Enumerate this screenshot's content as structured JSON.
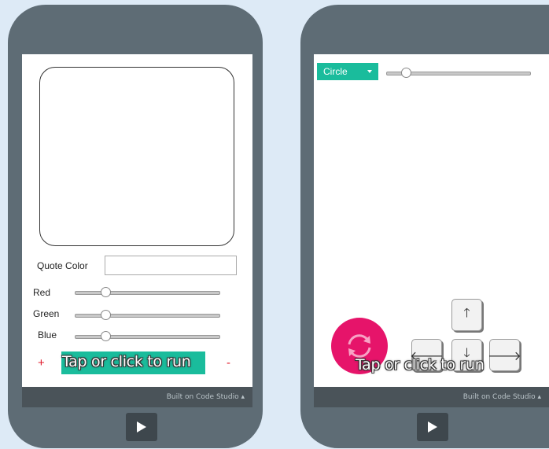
{
  "left_app": {
    "quote_color_label": "Quote Color",
    "quote_color_value": "",
    "sliders": [
      {
        "label": "Red",
        "value": 0.2
      },
      {
        "label": "Green",
        "value": 0.2
      },
      {
        "label": "Blue",
        "value": 0.2
      }
    ],
    "minus_label": "+",
    "plus_label": "-",
    "overlay_text": "Tap or click to run",
    "footer_text": "Built on Code Studio ▴",
    "run_icon": "play-icon"
  },
  "right_app": {
    "shape_select": {
      "selected": "Circle"
    },
    "size_slider_value": 0.13,
    "turn_icon": "rotate-icon",
    "arrows": {
      "up": "🡑",
      "left": "🡐",
      "down": "🡓",
      "right": "🡒"
    },
    "overlay_text": "Tap or click to run",
    "footer_text": "Built on Code Studio ▴",
    "run_icon": "play-icon"
  },
  "colors": {
    "accent": "#1abc9c",
    "turn_button": "#e6146a",
    "phone_frame": "#5e6c75",
    "background": "#ddeaf6"
  }
}
